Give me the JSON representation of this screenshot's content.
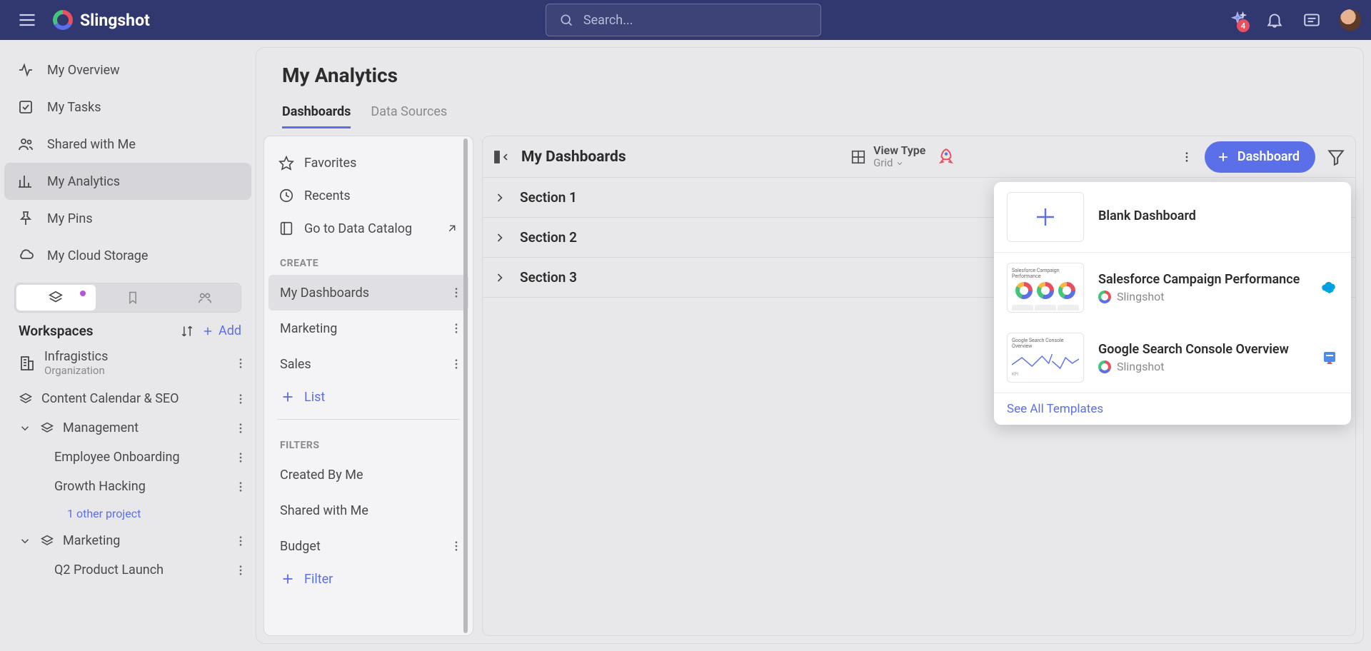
{
  "brand": "Slingshot",
  "search": {
    "placeholder": "Search..."
  },
  "topbar": {
    "notification_badge": "4"
  },
  "sidebar": {
    "items": [
      {
        "label": "My Overview"
      },
      {
        "label": "My Tasks"
      },
      {
        "label": "Shared with Me"
      },
      {
        "label": "My Analytics",
        "active": true
      },
      {
        "label": "My Pins"
      },
      {
        "label": "My Cloud Storage"
      }
    ],
    "workspaces_title": "Workspaces",
    "add_label": "Add",
    "org": {
      "name": "Infragistics",
      "sub": "Organization"
    },
    "ws": [
      {
        "label": "Content Calendar & SEO"
      },
      {
        "label": "Management",
        "children": [
          {
            "label": "Employee Onboarding"
          },
          {
            "label": "Growth Hacking"
          }
        ],
        "other": "1 other project"
      },
      {
        "label": "Marketing",
        "children": [
          {
            "label": "Q2 Product Launch"
          }
        ]
      }
    ]
  },
  "page": {
    "title": "My Analytics",
    "tabs": [
      "Dashboards",
      "Data Sources"
    ]
  },
  "panel": {
    "favorites": "Favorites",
    "recents": "Recents",
    "catalog": "Go to Data Catalog",
    "create_header": "CREATE",
    "create_items": [
      "My Dashboards",
      "Marketing",
      "Sales"
    ],
    "list_label": "List",
    "filters_header": "FILTERS",
    "filter_items": [
      "Created By Me",
      "Shared with Me",
      "Budget"
    ],
    "filter_label": "Filter"
  },
  "dash": {
    "title": "My Dashboards",
    "view_type_label": "View Type",
    "view_type_value": "Grid",
    "new_btn": "Dashboard",
    "sections": [
      "Section 1",
      "Section 2",
      "Section 3"
    ]
  },
  "popup": {
    "blank": "Blank Dashboard",
    "t1": {
      "title": "Salesforce Campaign Performance",
      "sub": "Slingshot"
    },
    "t2": {
      "title": "Google Search Console Overview",
      "sub": "Slingshot"
    },
    "footer": "See All Templates"
  }
}
